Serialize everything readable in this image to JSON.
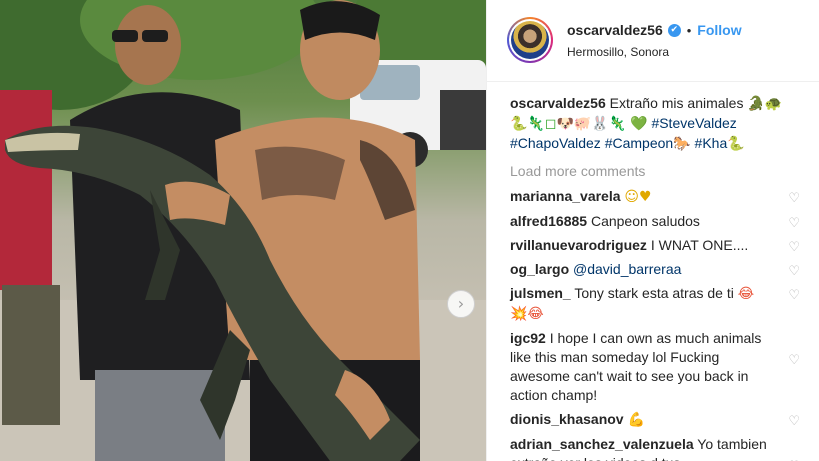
{
  "post": {
    "header": {
      "username": "oscarvaldez56",
      "verified_icon": "✔",
      "separator": "•",
      "follow_label": "Follow",
      "location": "Hermosillo, Sonora"
    },
    "caption": {
      "username": "oscarvaldez56",
      "text": "Extraño mis animales",
      "emoji_line1": "🐊🐢",
      "emoji_line2": "🐍🦎◻🐶🐖🐰🦎",
      "heart": "💚",
      "hashtags": [
        "#SteveValdez",
        "#ChapoValdez",
        "#Campeon",
        "#Kha"
      ],
      "emoji_after_campeon": "🐎",
      "emoji_after_kha": "🐍"
    },
    "load_more_label": "Load more comments",
    "comments": [
      {
        "user": "marianna_varela",
        "text": "",
        "emoji": "☺♥"
      },
      {
        "user": "alfred16885",
        "text": "Canpeon saludos",
        "emoji": ""
      },
      {
        "user": "rvillanuevarodriguez",
        "text": "I WNAT ONE....",
        "emoji": ""
      },
      {
        "user": "og_largo",
        "text": "@david_barreraa",
        "emoji": ""
      },
      {
        "user": "julsmen_",
        "text": "Tony stark esta atras de ti",
        "emoji": "😂💥😂"
      },
      {
        "user": "igc92",
        "text": "I hope I can own as much animals like this man someday lol Fucking awesome can't wait to see you back in action champ!",
        "emoji": ""
      },
      {
        "user": "dionis_khasanov",
        "text": "",
        "emoji": "💪"
      },
      {
        "user": "adrian_sanchez_valenzuela",
        "text": "Yo tambien extraño ver los videos d tus",
        "emoji": ""
      }
    ],
    "icons": {
      "next": "›",
      "heart": "♡"
    }
  }
}
